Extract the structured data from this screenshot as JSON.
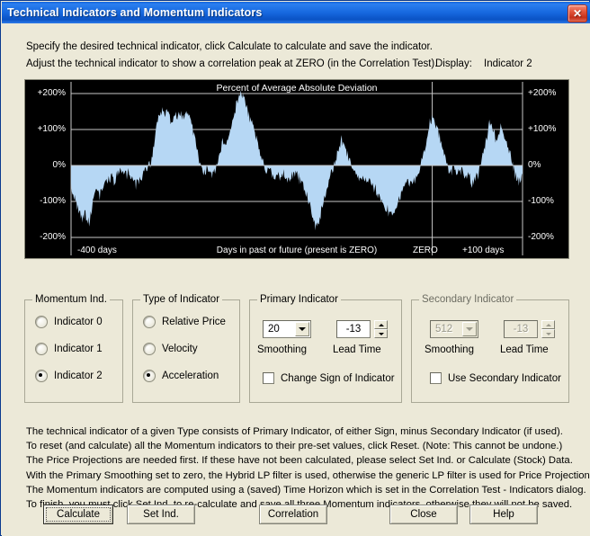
{
  "window": {
    "title": "Technical Indicators and Momentum Indicators",
    "close_icon": "close-icon"
  },
  "header": {
    "line1": "Specify the desired technical indicator, click Calculate to calculate and save the indicator.",
    "line2": "Adjust the technical indicator to show a correlation peak at ZERO (in the Correlation Test).",
    "display_label": "Display:",
    "display_value": "Indicator 2"
  },
  "chart_data": {
    "type": "area",
    "title": "Percent of Average Absolute Deviation",
    "xlabel": "Days in past or future (present is ZERO)",
    "ylabel": "Percent of Average Absolute Deviation",
    "x_tick_labels": [
      "-400 days",
      "ZERO",
      "+100 days"
    ],
    "y_tick_labels": [
      "+200%",
      "+100%",
      "0%",
      "-100%",
      "-200%"
    ],
    "ylim": [
      -200,
      200
    ],
    "xlim": [
      -400,
      100
    ],
    "grid": true,
    "legend": false,
    "background": "#000000",
    "series_color": "#b6d7f4",
    "gridline_color": "#c8c8c8",
    "zero_line_x": 0,
    "axis_left_labels": [
      "+200%",
      "+100%",
      "0%",
      "-100%",
      "-200%"
    ],
    "axis_right_labels": [
      "+200%",
      "+100%",
      "0%",
      "-100%",
      "-200%"
    ],
    "x": [
      -400,
      -396,
      -392,
      -388,
      -384,
      -380,
      -376,
      -372,
      -368,
      -364,
      -360,
      -356,
      -352,
      -348,
      -344,
      -340,
      -336,
      -332,
      -328,
      -324,
      -320,
      -316,
      -312,
      -308,
      -304,
      -300,
      -296,
      -292,
      -288,
      -284,
      -280,
      -276,
      -272,
      -268,
      -264,
      -260,
      -256,
      -252,
      -248,
      -244,
      -240,
      -236,
      -232,
      -228,
      -224,
      -220,
      -216,
      -212,
      -208,
      -204,
      -200,
      -196,
      -192,
      -188,
      -184,
      -180,
      -176,
      -172,
      -168,
      -164,
      -160,
      -156,
      -152,
      -148,
      -144,
      -140,
      -136,
      -132,
      -128,
      -124,
      -120,
      -116,
      -112,
      -108,
      -104,
      -100,
      -96,
      -92,
      -88,
      -84,
      -80,
      -76,
      -72,
      -68,
      -64,
      -60,
      -56,
      -52,
      -48,
      -44,
      -40,
      -36,
      -32,
      -28,
      -24,
      -20,
      -16,
      -12,
      -8,
      -4,
      0,
      4,
      8,
      12,
      16,
      20,
      24,
      28,
      32,
      36,
      40,
      44,
      48,
      52,
      56,
      60,
      64,
      68,
      72,
      76,
      80,
      84,
      88,
      92,
      96,
      100
    ],
    "values": [
      -60,
      -95,
      -120,
      -150,
      -135,
      -160,
      -100,
      -70,
      -85,
      -60,
      -40,
      -30,
      -45,
      -25,
      -15,
      -28,
      -20,
      -35,
      -55,
      -40,
      -25,
      -10,
      5,
      60,
      130,
      155,
      140,
      148,
      120,
      140,
      150,
      138,
      145,
      130,
      95,
      40,
      -5,
      -20,
      -12,
      -25,
      -8,
      25,
      70,
      55,
      90,
      130,
      175,
      205,
      190,
      150,
      120,
      85,
      45,
      10,
      -18,
      -10,
      -30,
      -20,
      -38,
      -25,
      -45,
      -30,
      -22,
      -35,
      -50,
      -75,
      -110,
      -150,
      -175,
      -140,
      -100,
      -60,
      -25,
      10,
      45,
      70,
      50,
      20,
      -10,
      -25,
      -40,
      -30,
      -50,
      -45,
      -62,
      -80,
      -100,
      -120,
      -128,
      -125,
      -118,
      -90,
      -60,
      -40,
      -55,
      -42,
      -20,
      10,
      55,
      105,
      130,
      115,
      80,
      40,
      5,
      -20,
      -8,
      -28,
      -15,
      -40,
      -22,
      -55,
      -35,
      -18,
      30,
      75,
      120,
      95,
      60,
      115,
      85,
      60,
      20,
      -30,
      -40,
      -25,
      -45,
      -30,
      -35,
      -20
    ]
  },
  "chart": {
    "title": "Percent of Average Absolute Deviation",
    "y_labels": [
      "+200%",
      "+100%",
      "0%",
      "-100%",
      "-200%"
    ],
    "x_left": "-400 days",
    "x_center": "Days in past or future (present is ZERO)",
    "x_zero": "ZERO",
    "x_right": "+100 days"
  },
  "momentum_group": {
    "legend": "Momentum Ind.",
    "options": [
      {
        "label": "Indicator 0",
        "selected": false
      },
      {
        "label": "Indicator 1",
        "selected": false
      },
      {
        "label": "Indicator 2",
        "selected": true
      }
    ]
  },
  "type_group": {
    "legend": "Type of Indicator",
    "options": [
      {
        "label": "Relative Price",
        "selected": false
      },
      {
        "label": "Velocity",
        "selected": false
      },
      {
        "label": "Acceleration",
        "selected": true
      }
    ]
  },
  "primary_group": {
    "legend": "Primary Indicator",
    "smoothing_value": "20",
    "smoothing_label": "Smoothing",
    "lead_time_value": "-13",
    "lead_time_label": "Lead Time",
    "checkbox_label": "Change Sign of Indicator",
    "checkbox_checked": false
  },
  "secondary_group": {
    "legend": "Secondary Indicator",
    "smoothing_value": "512",
    "smoothing_label": "Smoothing",
    "lead_time_value": "-13",
    "lead_time_label": "Lead Time",
    "checkbox_label": "Use Secondary Indicator",
    "checkbox_checked": false,
    "disabled": true
  },
  "notes": [
    "The technical indicator of a given Type consists of Primary Indicator, of either Sign, minus Secondary Indicator (if used).",
    "To reset (and calculate) all the Momentum indicators to their pre-set values, click Reset.  (Note: This cannot be undone.)",
    "The Price Projections are needed first. If these have not been calculated, please select Set Ind. or Calculate (Stock) Data.",
    "With the Primary Smoothing set to zero, the Hybrid LP filter is used, otherwise the generic LP filter is used for Price Projections.",
    "The Momentum indicators are computed using a (saved) Time Horizon which is set in the Correlation Test - Indicators dialog.",
    "To finish, you must click Set Ind. to re-calculate and save all three Momentum indicators, otherwise they will not be saved."
  ],
  "buttons": {
    "calculate": "Calculate",
    "set_ind": "Set Ind.",
    "correlation": "Correlation",
    "close": "Close",
    "help": "Help"
  },
  "colors": {
    "titlebar_blue": "#1667de",
    "dialog_face": "#ece9d8",
    "chart_bg": "#000000",
    "chart_series": "#b6d7f4"
  }
}
